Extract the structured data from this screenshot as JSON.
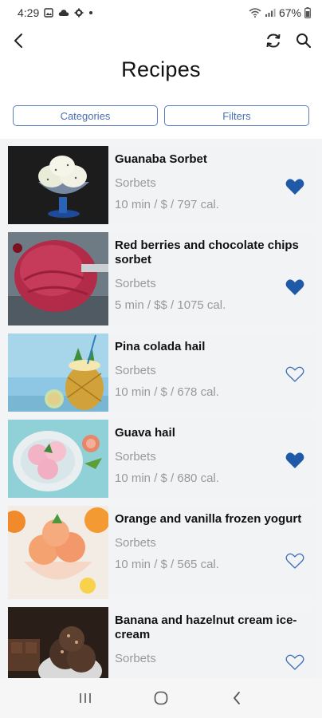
{
  "status_bar": {
    "time": "4:29",
    "battery": "67%"
  },
  "header": {
    "title": "Recipes",
    "icons": [
      "back-arrow-icon",
      "refresh-icon",
      "search-icon"
    ]
  },
  "filters": {
    "categories_label": "Categories",
    "filters_label": "Filters"
  },
  "recipes": [
    {
      "title": "Guanaba Sorbet",
      "category": "Sorbets",
      "meta": "10 min / $ / 797 cal.",
      "favorite": true
    },
    {
      "title": "Red berries and chocolate chips sorbet",
      "category": "Sorbets",
      "meta": "5 min / $$ / 1075 cal.",
      "favorite": true
    },
    {
      "title": "Pina colada hail",
      "category": "Sorbets",
      "meta": "10 min / $ / 678 cal.",
      "favorite": false
    },
    {
      "title": "Guava hail",
      "category": "Sorbets",
      "meta": "10 min / $ / 680 cal.",
      "favorite": true
    },
    {
      "title": "Orange and vanilla frozen yogurt",
      "category": "Sorbets",
      "meta": "10 min / $ / 565 cal.",
      "favorite": false
    },
    {
      "title": "Banana and hazelnut cream ice-cream",
      "category": "Sorbets",
      "meta": "",
      "favorite": false
    }
  ],
  "colors": {
    "accent": "#1f5aa8",
    "pill_border": "#5b7db8",
    "muted_text": "#999999"
  }
}
